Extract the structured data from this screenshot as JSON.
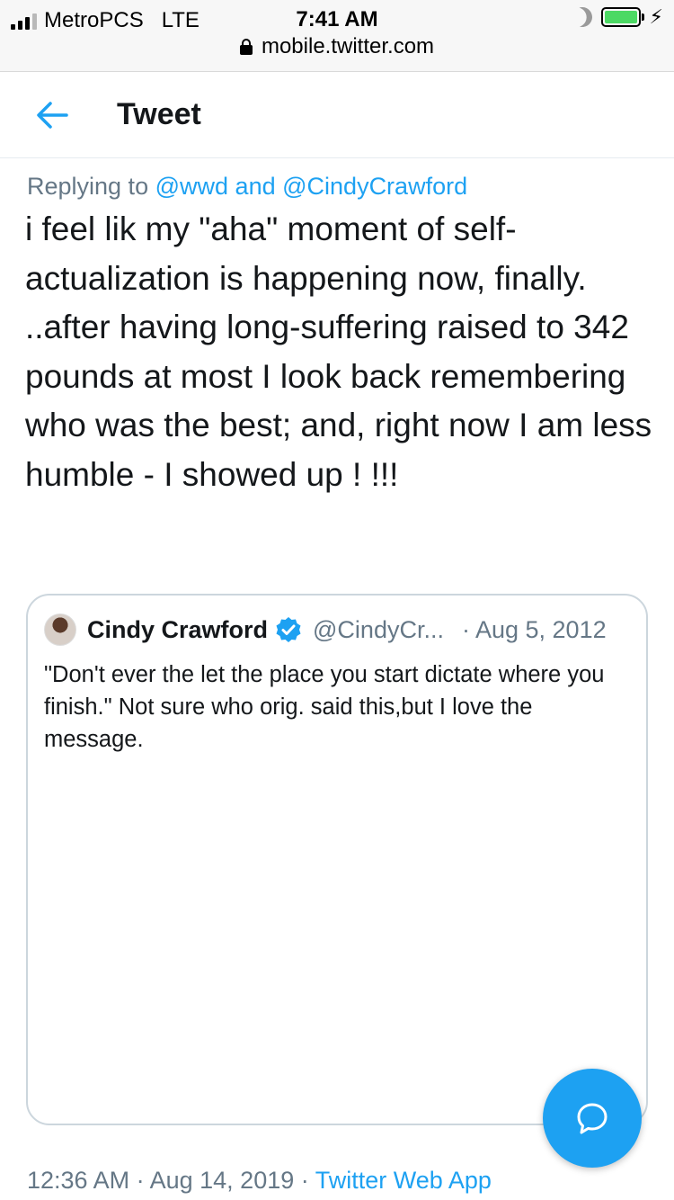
{
  "status_bar": {
    "carrier": "MetroPCS",
    "network": "LTE",
    "time": "7:41 AM",
    "url": "mobile.twitter.com",
    "icons": [
      "signal-icon",
      "moon-icon",
      "battery-icon",
      "charging-bolt-icon",
      "lock-icon"
    ]
  },
  "header": {
    "title": "Tweet",
    "back_icon": "back-arrow-icon"
  },
  "tweet": {
    "replying_prefix": "Replying to",
    "reply_to_1": "@wwd",
    "reply_joiner": "and",
    "reply_to_2": "@CindyCrawford",
    "text": "i feel lik my \"aha\" moment of self-actualization is happening now, finally. ..after having long-suffering raised to 342 pounds at most I look back remembering who was the best; and, right now I am less humble - I showed up ! !!!"
  },
  "quoted_tweet": {
    "name": "Cindy Crawford",
    "handle": "@CindyCr...",
    "date": "· Aug 5, 2012",
    "text": "\"Don't ever the let the place you start dictate where you finish.\" Not sure who orig. said this,but I love the message.",
    "verified_icon": "verified-badge-icon"
  },
  "meta": {
    "time": "12:36 AM",
    "sep1": " · ",
    "date": "Aug 14, 2019",
    "sep2": " · ",
    "app": "Twitter Web App"
  },
  "fab": {
    "icon": "compose-reply-icon"
  },
  "colors": {
    "accent": "#1da1f2",
    "secondary_text": "#657786",
    "primary_text": "#14171a",
    "border": "#ccd6dd"
  }
}
